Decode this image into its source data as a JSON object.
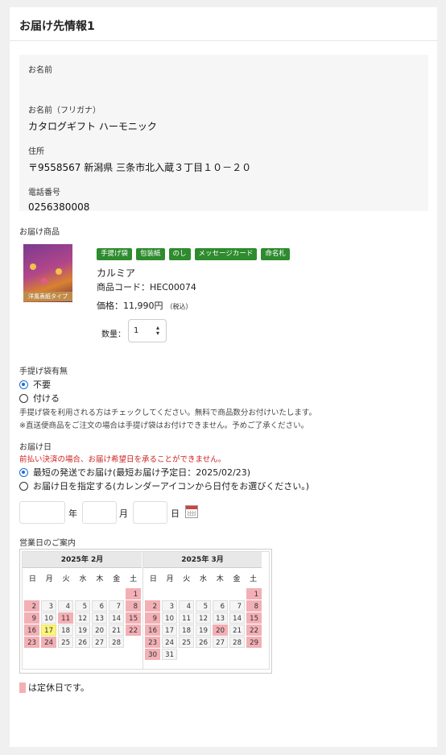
{
  "header": {
    "title": "お届け先情報1"
  },
  "recipient": {
    "name_label": "お名前",
    "name_value": "",
    "kana_label": "お名前（フリガナ）",
    "kana_value": "カタログギフト  ハーモニック",
    "address_label": "住所",
    "address_value": "〒9558567 新潟県 三条市北入蔵３丁目１０－２０",
    "phone_label": "電話番号",
    "phone_value": "0256380008"
  },
  "product": {
    "section_label": "お届け商品",
    "image_caption": "洋風表紙タイプ",
    "tags": [
      "手提げ袋",
      "包装紙",
      "のし",
      "メッセージカード",
      "命名札"
    ],
    "name": "カルミア",
    "code": "商品コード：HEC00074",
    "price": "価格：11,990円",
    "tax_note": "（税込）",
    "qty_label": "数量：",
    "qty_value": "1"
  },
  "bag": {
    "label": "手提げ袋有無",
    "options": [
      "不要",
      "付ける"
    ],
    "selected": "不要",
    "note1": "手提げ袋を利用される方はチェックしてください。無料で商品数分お付けいたします。",
    "note2": "※直送便商品をご注文の場合は手提げ袋はお付けできません。予めご了承ください。"
  },
  "delivery": {
    "label": "お届け日",
    "warning": "前払い決済の場合、お届け希望日を承ることができません。",
    "option_fastest": "最短の発送でお届け(最短お届け予定日：2025/02/23)",
    "option_specify": "お届け日を指定する(カレンダーアイコンから日付をお選びください。)",
    "unit_year": "年",
    "unit_month": "月",
    "unit_day": "日"
  },
  "calendar": {
    "label": "営業日のご案内",
    "weekdays": [
      "日",
      "月",
      "火",
      "水",
      "木",
      "金",
      "土"
    ],
    "months": [
      {
        "title": "2025年 2月",
        "offset": 6,
        "days": 28,
        "holidays": [
          1,
          2,
          8,
          9,
          11,
          15,
          16,
          22,
          23,
          24
        ],
        "today": 17
      },
      {
        "title": "2025年 3月",
        "offset": 6,
        "days": 31,
        "holidays": [
          1,
          2,
          8,
          9,
          15,
          16,
          20,
          22,
          23,
          29,
          30
        ],
        "today": null
      }
    ],
    "legend": "は定休日です。",
    "colors": {
      "holiday": "#f2b0b5",
      "today": "#fbf57a"
    }
  }
}
